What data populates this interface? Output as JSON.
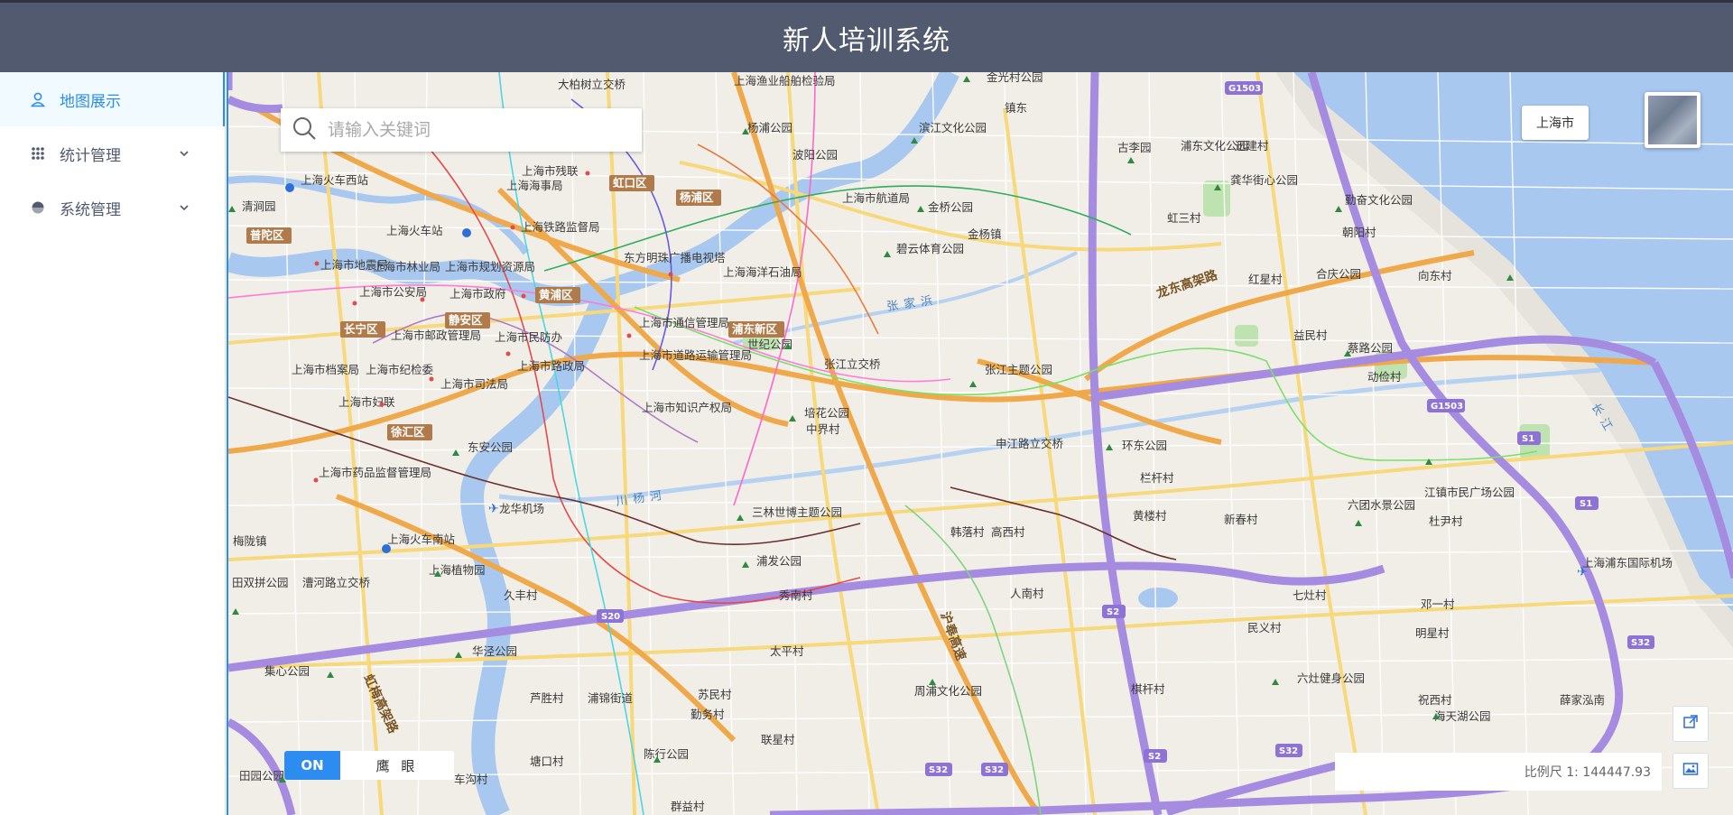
{
  "header": {
    "title": "新人培训系统"
  },
  "sidebar": {
    "items": [
      {
        "label": "地图展示",
        "icon": "user-location-icon",
        "active": true
      },
      {
        "label": "统计管理",
        "icon": "grid-icon",
        "active": false
      },
      {
        "label": "系统管理",
        "icon": "pie-icon",
        "active": false
      }
    ]
  },
  "map": {
    "search_placeholder": "请输入关键词",
    "city_button": "上海市",
    "eagle_eye": {
      "state": "ON",
      "label": "鹰 眼"
    },
    "scale_text": "比例尺 1: 144447.93",
    "districts": [
      "虹口区",
      "杨浦区",
      "普陀区",
      "黄浦区",
      "静安区",
      "长宁区",
      "浦东新区",
      "徐汇区"
    ],
    "places": [
      "上海渔业船舶检验局",
      "大柏树立交桥",
      "金光村公园",
      "镇东",
      "杨浦公园",
      "波阳公园",
      "滨江文化公园",
      "上海市残联",
      "上海海事局",
      "上海火车西站",
      "清涧园",
      "上海火车站",
      "上海铁路监督局",
      "上海市航道局",
      "金桥公园",
      "古李园",
      "浦东文化公园",
      "迅建村",
      "龚华街心公园",
      "勤奋文化公园",
      "朝阳村",
      "虹三村",
      "碧云体育公园",
      "金杨镇",
      "东方明珠广播电视塔",
      "上海市规划资源局",
      "上海市政府",
      "上海海洋石油局",
      "红星村",
      "合庆公园",
      "向东村",
      "上海市地震局",
      "上海市林业局",
      "上海市公安局",
      "上海市邮政管理局",
      "上海市民防办",
      "上海市通信管理局",
      "上海市道路运输管理局",
      "世纪公园",
      "张江立交桥",
      "张江主题公园",
      "益民村",
      "蔡路公园",
      "动俭村",
      "上海市档案局",
      "上海市纪检委",
      "上海市司法局",
      "上海市路政局",
      "上海市妇联",
      "上海市知识产权局",
      "培花公园",
      "中界村",
      "申江路立交桥",
      "环东公园",
      "东安公园",
      "栏杆村",
      "上海市药品监督管理局",
      "龙华机场",
      "三林世博主题公园",
      "韩落村",
      "高西村",
      "黄楼村",
      "新春村",
      "江镇市民广场公园",
      "六团水景公园",
      "杜尹村",
      "梅陇镇",
      "上海火车南站",
      "上海植物园",
      "浦发公园",
      "上海浦东国际机场",
      "田双拼公园",
      "漕河路立交桥",
      "久丰村",
      "秀南村",
      "人南村",
      "七灶村",
      "邓一村",
      "民义村",
      "明星村",
      "集心公园",
      "华泾公园",
      "太平村",
      "棋杆村",
      "六灶健身公园",
      "周浦文化公园",
      "芦胜村",
      "浦锦街道",
      "苏民村",
      "勤务村",
      "联星村",
      "祝西村",
      "海天湖公园",
      "薛家泓南",
      "田园公园",
      "塘口村",
      "陈行公园",
      "车沟村",
      "群益村"
    ],
    "roads": [
      "龙东高架路",
      "沪奉高速",
      "虹梅高架路"
    ],
    "water": [
      "川杨河",
      "张家浜",
      "长江"
    ],
    "shields": [
      "G1503",
      "S20",
      "S2",
      "S32",
      "S1"
    ]
  }
}
